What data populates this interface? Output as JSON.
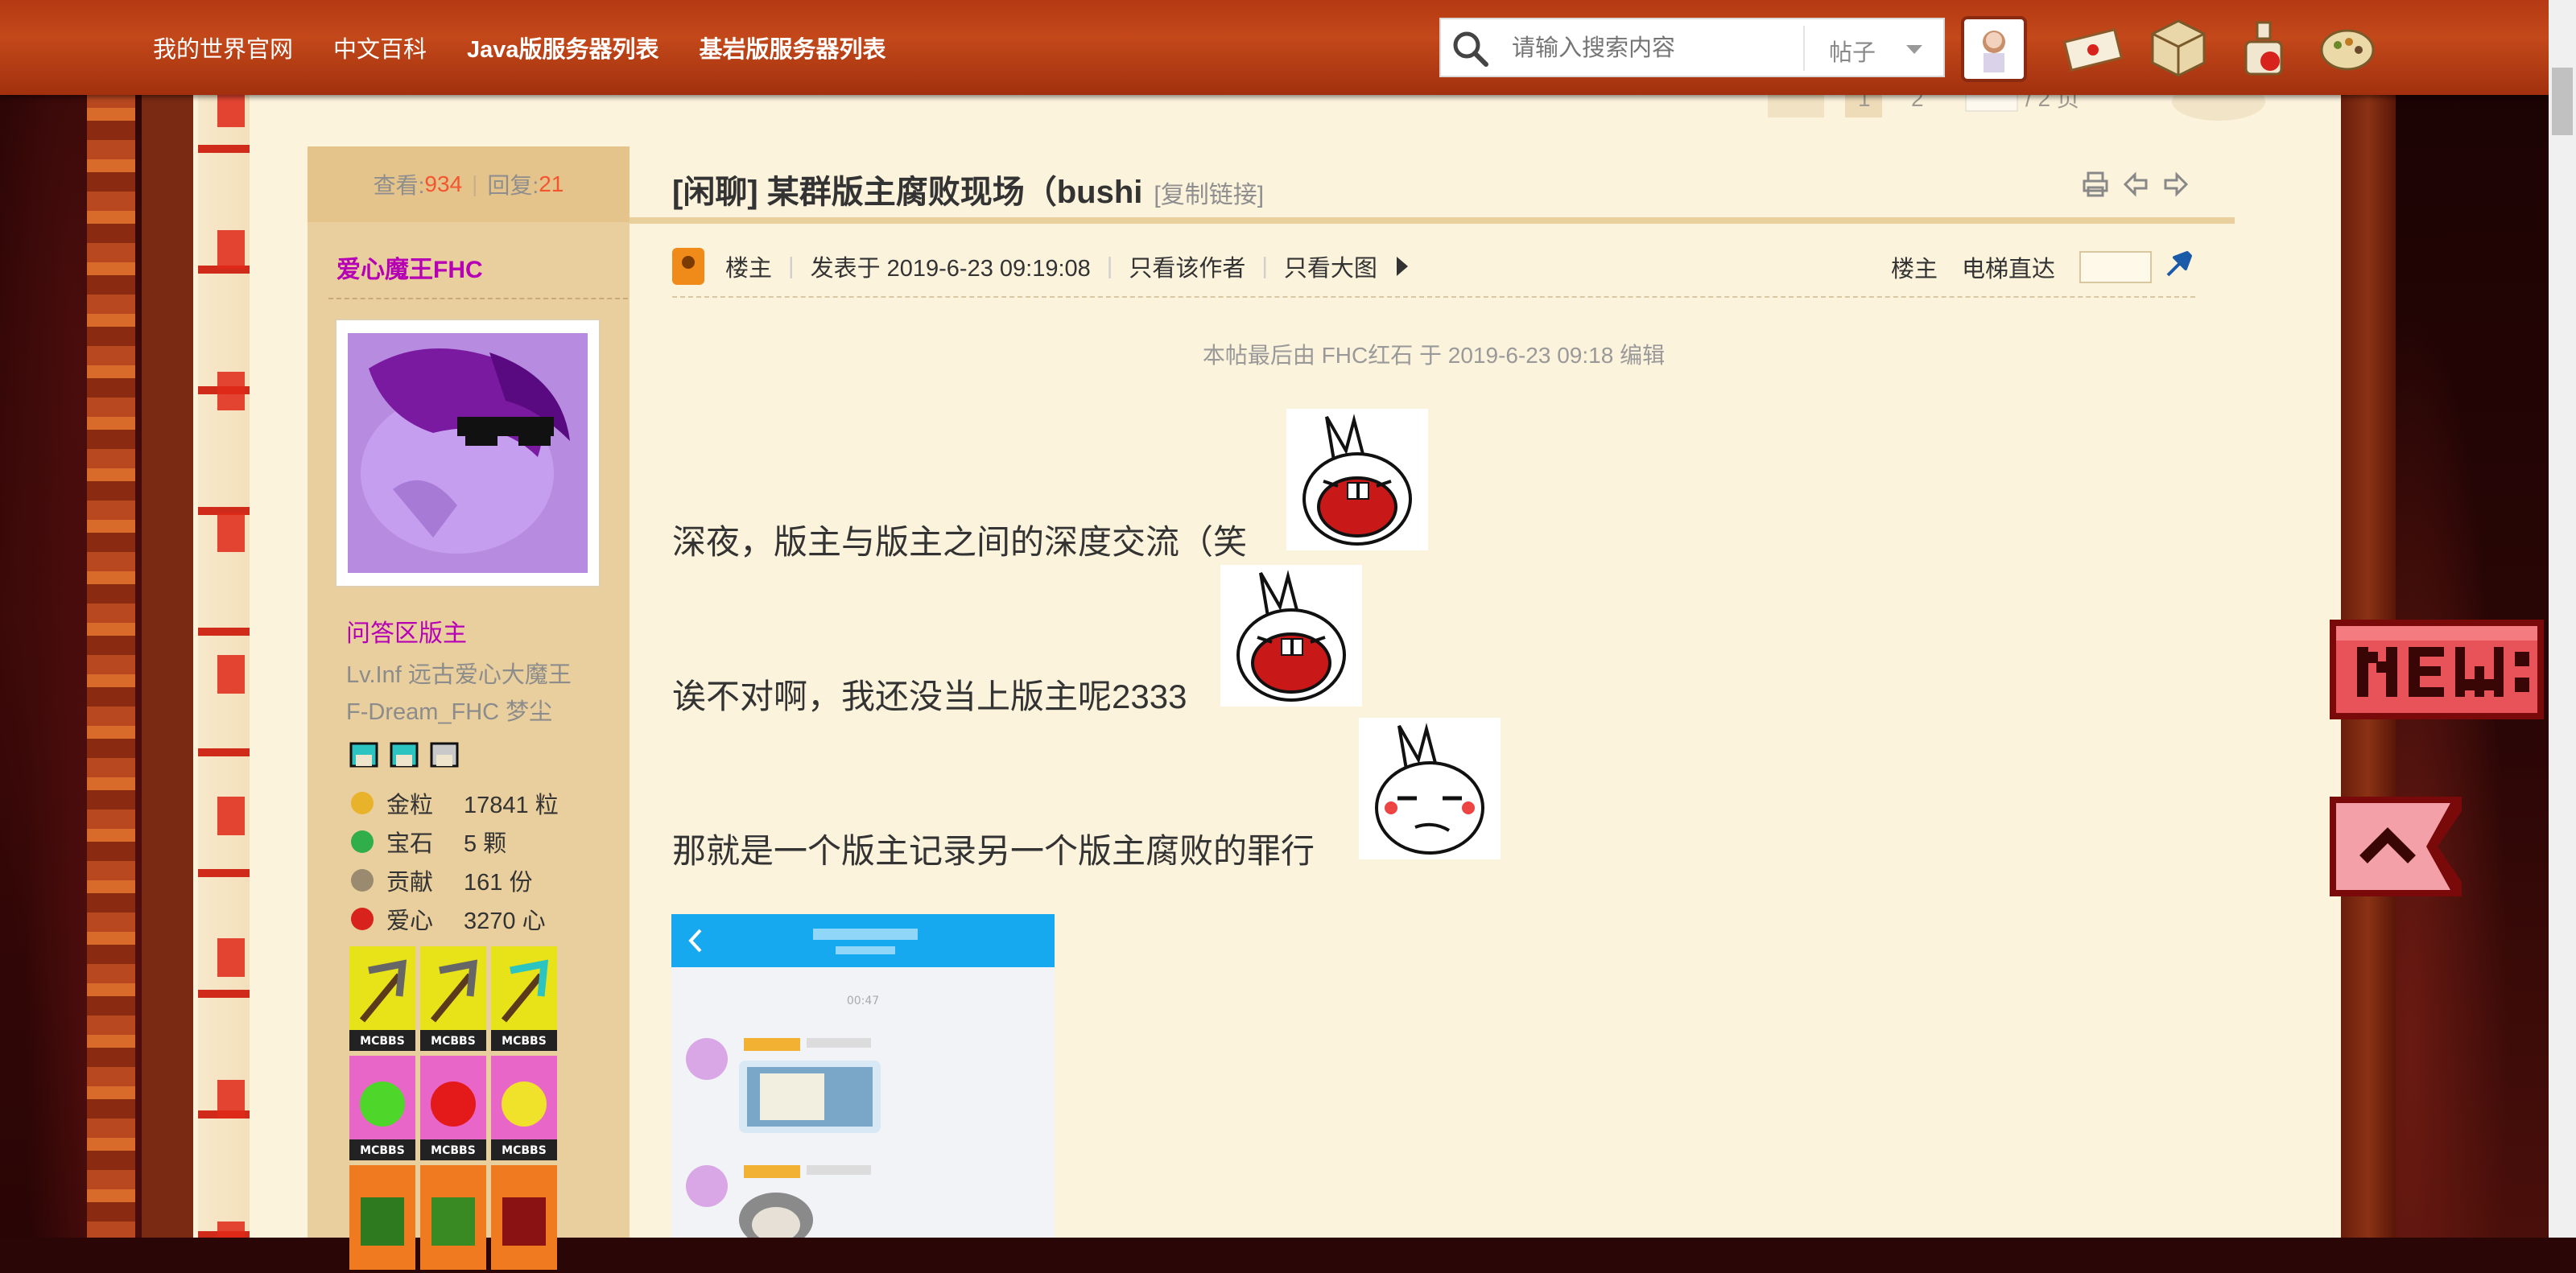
{
  "nav": {
    "links": [
      "我的世界官网",
      "中文百科",
      "Java版服务器列表",
      "基岩版服务器列表"
    ]
  },
  "search": {
    "placeholder": "请输入搜索内容",
    "type": "帖子"
  },
  "pager": {
    "current": "1",
    "next": "2",
    "total": "/ 2 页"
  },
  "thread": {
    "stats": {
      "views_label": "查看:",
      "views": "934",
      "replies_label": "回复:",
      "replies": "21"
    },
    "title": "[闲聊] 某群版主腐败现场（bushi",
    "copy_link": "[复制链接]"
  },
  "post": {
    "op_label": "楼主",
    "posted": "发表于 2019-6-23 09:19:08",
    "only_author": "只看该作者",
    "only_images": "只看大图",
    "floor_label": "楼主",
    "jump_label": "电梯直达",
    "edit_note": "本帖最后由 FHC红石 于 2019-6-23 09:18 编辑",
    "lines": [
      "深夜，版主与版主之间的深度交流（笑",
      "诶不对啊，我还没当上版主呢2333",
      "那就是一个版主记录另一个版主腐败的罪行"
    ],
    "screenshot_time": "00:47"
  },
  "author": {
    "name": "爱心魔王FHC",
    "role": "问答区版主",
    "title_line1": "Lv.Inf 远古爱心大魔王",
    "title_line2": "F-Dream_FHC 梦尘",
    "stats": [
      {
        "label": "金粒",
        "value": "17841 粒",
        "color": "#e8b32a"
      },
      {
        "label": "宝石",
        "value": "5 颗",
        "color": "#2fae4a"
      },
      {
        "label": "贡献",
        "value": "161 份",
        "color": "#9a8a70"
      },
      {
        "label": "爱心",
        "value": "3270 心",
        "color": "#d8231c"
      }
    ],
    "medal_tag": "MCBBS"
  },
  "colors": {
    "nav": "#b53a14",
    "accent_red": "#f3552f",
    "author_purple": "#b600b6",
    "sidebar": "#e9cf9d",
    "paper": "#fcf3dd"
  },
  "icons": [
    "search-icon",
    "print-icon",
    "prev-thread-icon",
    "next-thread-icon",
    "jump-icon"
  ]
}
